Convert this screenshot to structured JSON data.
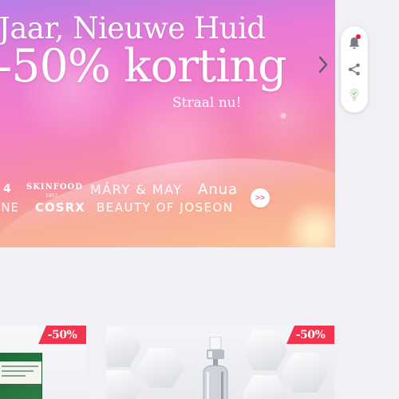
{
  "banner": {
    "title": "Jaar, Nieuwe Huid",
    "discount": "-50% korting",
    "cta": "Straal nu!",
    "brands": {
      "row1": [
        "4",
        "SKINFOOD",
        "MÁRY & MAY",
        "Anua"
      ],
      "row1_sub": "1957",
      "row2": [
        "INE",
        "COSRX",
        "BEAUTY OF JOSEON"
      ]
    },
    "more_label": ">>"
  },
  "products": [
    {
      "discount": "-50%"
    },
    {
      "discount": "-50%"
    }
  ],
  "colors": {
    "discount_badge": "#f0364e",
    "notification_dot": "#e8202f",
    "page_background": "#f0f0f5"
  },
  "icons": [
    "chevron-right-icon",
    "bell-icon",
    "share-icon",
    "lightbulb-icon"
  ]
}
